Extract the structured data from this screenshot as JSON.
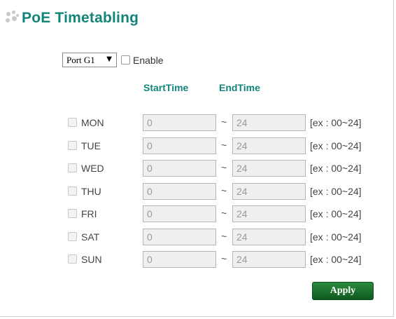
{
  "page": {
    "title": "PoE Timetabling"
  },
  "port": {
    "selected": "Port G1",
    "arrow": "▼"
  },
  "enable": {
    "label": "Enable",
    "checked": false
  },
  "headers": {
    "start": "StartTime",
    "end": "EndTime"
  },
  "separator": "~",
  "days": [
    {
      "label": "MON",
      "start": "0",
      "end": "24",
      "hint": "[ex : 00~24]"
    },
    {
      "label": "TUE",
      "start": "0",
      "end": "24",
      "hint": "[ex : 00~24]"
    },
    {
      "label": "WED",
      "start": "0",
      "end": "24",
      "hint": "[ex : 00~24]"
    },
    {
      "label": "THU",
      "start": "0",
      "end": "24",
      "hint": "[ex : 00~24]"
    },
    {
      "label": "FRI",
      "start": "0",
      "end": "24",
      "hint": "[ex : 00~24]"
    },
    {
      "label": "SAT",
      "start": "0",
      "end": "24",
      "hint": "[ex : 00~24]"
    },
    {
      "label": "SUN",
      "start": "0",
      "end": "24",
      "hint": "[ex : 00~24]"
    }
  ],
  "apply_label": "Apply",
  "colors": {
    "accent": "#13847a",
    "button": "#1a6e2c"
  }
}
